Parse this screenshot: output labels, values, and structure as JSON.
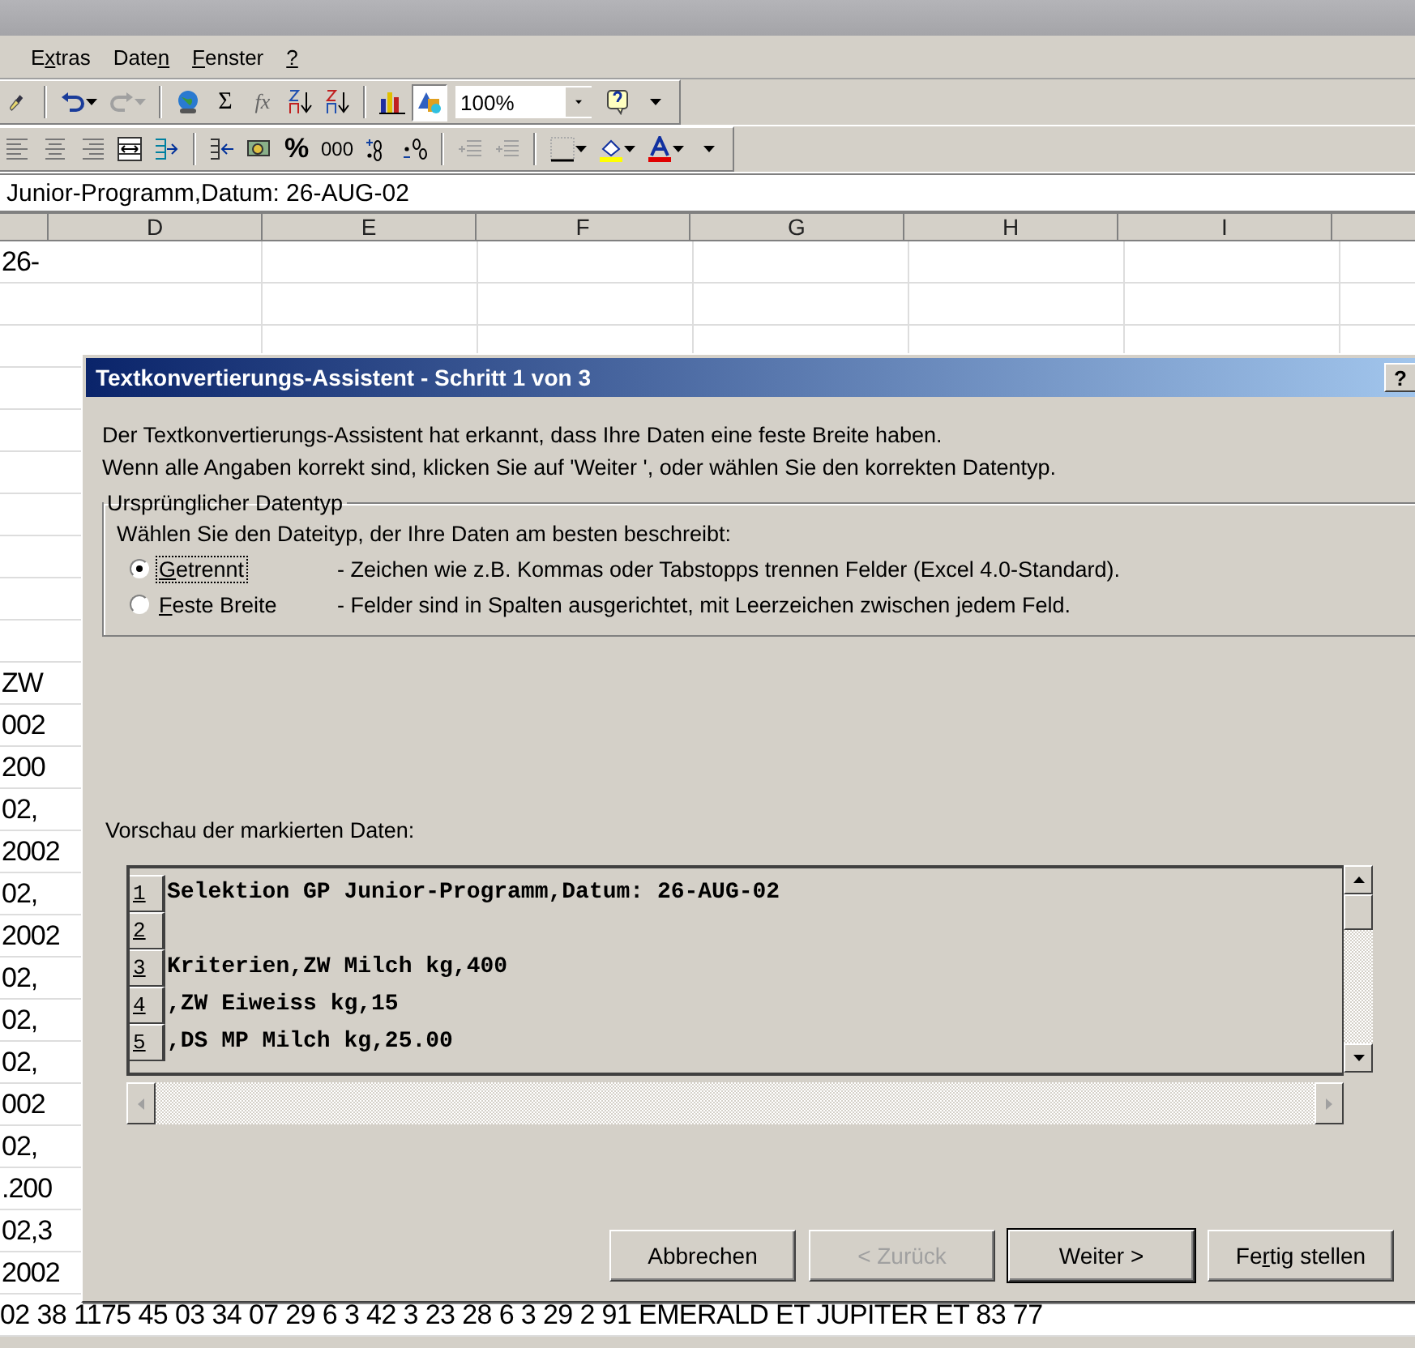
{
  "menu": [
    {
      "start": "E",
      "key": "x",
      "end": "tras"
    },
    {
      "start": "Date",
      "key": "n"
    },
    {
      "key": "F",
      "end": "enster"
    },
    {
      "key": "?"
    }
  ],
  "toolbar_standard": {
    "redo": {
      "disabled": true
    },
    "sum_button": "Σ",
    "function_button": "fx",
    "drawing_button": {
      "pressed": true
    },
    "zoom": "100%"
  },
  "toolbar_format": {
    "percent_button": "%",
    "thousands_button": "000",
    "indent": {
      "disabled": true
    }
  },
  "formula_bar": {
    "value": "Junior-Programm,Datum: 26-AUG-02"
  },
  "columns": [
    {
      "kind": "partial"
    },
    {
      "kind": "column",
      "label": "D"
    },
    {
      "kind": "column",
      "label": "E"
    },
    {
      "kind": "column",
      "label": "F"
    },
    {
      "kind": "column",
      "label": "G"
    },
    {
      "kind": "column",
      "label": "H"
    },
    {
      "kind": "column",
      "label": "I"
    },
    {
      "kind": "partial"
    }
  ],
  "rows": [
    {
      "kind": "cell",
      "text": "26-"
    },
    {
      "kind": "blank"
    },
    {
      "kind": "blank"
    },
    {
      "kind": "blank"
    },
    {
      "kind": "blank"
    },
    {
      "kind": "blank"
    },
    {
      "kind": "blank"
    },
    {
      "kind": "blank"
    },
    {
      "kind": "blank"
    },
    {
      "kind": "blank"
    },
    {
      "kind": "cell",
      "text": "ZW"
    },
    {
      "kind": "cell",
      "text": "002"
    },
    {
      "kind": "cell",
      "text": "200"
    },
    {
      "kind": "cell",
      "text": "02,"
    },
    {
      "kind": "cell",
      "text": "2002"
    },
    {
      "kind": "cell",
      "text": "02,"
    },
    {
      "kind": "cell",
      "text": "2002"
    },
    {
      "kind": "cell",
      "text": "02,"
    },
    {
      "kind": "cell",
      "text": "02,"
    },
    {
      "kind": "cell",
      "text": "02,"
    },
    {
      "kind": "cell",
      "text": "002"
    },
    {
      "kind": "cell",
      "text": "02,"
    },
    {
      "kind": "cell",
      "text": ".200"
    },
    {
      "kind": "cell",
      "text": "02,3"
    },
    {
      "kind": "cell",
      "text": "2002"
    },
    {
      "kind": "spill",
      "text": "02 38 1175 45   03 34   07 29 6 3 42 3 23 28 6 3 29 2 91 EMERALD ET JUPITER ET 83 77"
    }
  ],
  "dialog": {
    "title": "Textkonvertierungs-Assistent - Schritt 1 von 3",
    "help_button": "?",
    "intro": [
      "Der Textkonvertierungs-Assistent hat erkannt, dass Ihre Daten eine feste Breite haben.",
      "Wenn alle Angaben korrekt sind, klicken Sie auf 'Weiter ', oder wählen Sie den korrekten Datentyp."
    ],
    "group": {
      "title": "Ursprünglicher Datentyp",
      "prompt": "Wählen Sie den Dateityp, der Ihre Daten am besten beschreibt:",
      "options": [
        {
          "label": {
            "key": "G",
            "end": "etrennt"
          },
          "description": "- Zeichen wie z.B. Kommas oder Tabstopps trennen Felder (Excel 4.0-Standard).",
          "selected": true,
          "focused": true
        },
        {
          "label": {
            "key": "F",
            "end": "este Breite"
          },
          "description": "- Felder sind in Spalten ausgerichtet, mit Leerzeichen zwischen jedem Feld.",
          "selected": false,
          "focused": false
        }
      ]
    },
    "preview_label": "Vorschau der markierten Daten:",
    "preview_lines": [
      {
        "number": "1",
        "text": "Selektion GP Junior-Programm,Datum: 26-AUG-02"
      },
      {
        "number": "2"
      },
      {
        "number": "3",
        "text": "Kriterien,ZW Milch kg,400"
      },
      {
        "number": "4",
        "text": ",ZW Eiweiss kg,15"
      },
      {
        "number": "5",
        "text": ",DS MP Milch kg,25.00"
      }
    ],
    "buttons": [
      {
        "label": {
          "start": "Abbrechen"
        },
        "disabled": false,
        "default": false
      },
      {
        "label": {
          "start": "< Zurück"
        },
        "disabled": true,
        "default": false
      },
      {
        "label": {
          "start": "Weiter >"
        },
        "disabled": false,
        "default": true
      },
      {
        "label": {
          "start": "Fe",
          "key": "r",
          "end": "tig stellen"
        },
        "disabled": false,
        "default": false
      }
    ]
  }
}
